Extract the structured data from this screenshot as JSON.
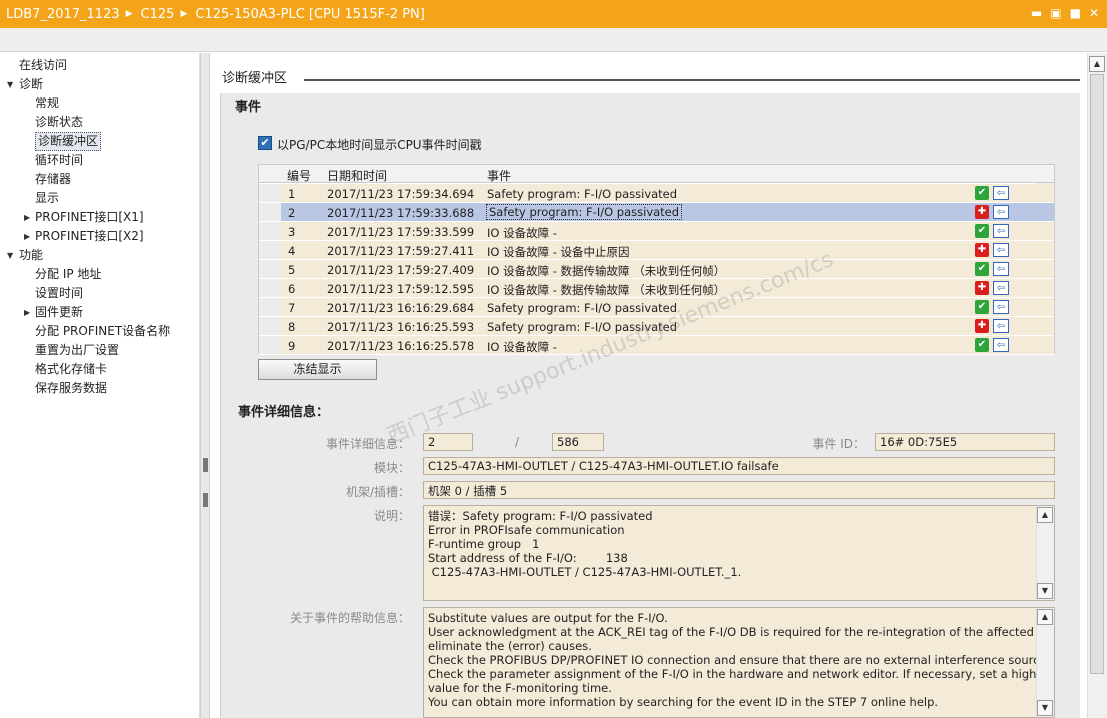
{
  "titlebar": {
    "crumbs": [
      "LDB7_2017_1123",
      "C125",
      "C125-150A3-PLC [CPU 1515F-2 PN]"
    ],
    "sep": "▶",
    "btn_min": "▬",
    "btn_restore": "▣",
    "btn_max": "■",
    "btn_close": "✕"
  },
  "nav": {
    "items": [
      {
        "label": "在线访问",
        "level": 0
      },
      {
        "label": "诊断",
        "level": 0,
        "expand": "▼"
      },
      {
        "label": "常规",
        "level": 1
      },
      {
        "label": "诊断状态",
        "level": 1
      },
      {
        "label": "诊断缓冲区",
        "level": 1,
        "selected": true
      },
      {
        "label": "循环时间",
        "level": 1
      },
      {
        "label": "存储器",
        "level": 1
      },
      {
        "label": "显示",
        "level": 1
      },
      {
        "label": "PROFINET接口[X1]",
        "level": 1,
        "expand": "▶"
      },
      {
        "label": "PROFINET接口[X2]",
        "level": 1,
        "expand": "▶"
      },
      {
        "label": "功能",
        "level": 0,
        "expand": "▼"
      },
      {
        "label": "分配 IP 地址",
        "level": 1
      },
      {
        "label": "设置时间",
        "level": 1
      },
      {
        "label": "固件更新",
        "level": 1,
        "expand": "▶"
      },
      {
        "label": "分配 PROFINET设备名称",
        "level": 1
      },
      {
        "label": "重置为出厂设置",
        "level": 1
      },
      {
        "label": "格式化存储卡",
        "level": 1
      },
      {
        "label": "保存服务数据",
        "level": 1
      }
    ]
  },
  "section_title": "诊断缓冲区",
  "events_title": "事件",
  "checkbox": {
    "checked": "✔",
    "label": "以PG/PC本地时间显示CPU事件时间戳"
  },
  "table": {
    "headers": {
      "num": "编号",
      "datetime": "日期和时间",
      "event": "事件"
    },
    "rows": [
      {
        "num": "1",
        "datetime": "2017/11/23 17:59:34.694",
        "event": "Safety program: F-I/O passivated",
        "status": "ok"
      },
      {
        "num": "2",
        "datetime": "2017/11/23 17:59:33.688",
        "event": "Safety program: F-I/O passivated",
        "status": "err",
        "selected": true
      },
      {
        "num": "3",
        "datetime": "2017/11/23 17:59:33.599",
        "event": "IO 设备故障 -",
        "status": "ok"
      },
      {
        "num": "4",
        "datetime": "2017/11/23 17:59:27.411",
        "event": "IO 设备故障 - 设备中止原因",
        "status": "err"
      },
      {
        "num": "5",
        "datetime": "2017/11/23 17:59:27.409",
        "event": "IO 设备故障 - 数据传输故障 （未收到任何帧）",
        "status": "ok"
      },
      {
        "num": "6",
        "datetime": "2017/11/23 17:59:12.595",
        "event": "IO 设备故障 - 数据传输故障 （未收到任何帧）",
        "status": "err"
      },
      {
        "num": "7",
        "datetime": "2017/11/23 16:16:29.684",
        "event": "Safety program: F-I/O passivated",
        "status": "ok"
      },
      {
        "num": "8",
        "datetime": "2017/11/23 16:16:25.593",
        "event": "Safety program: F-I/O passivated",
        "status": "err"
      },
      {
        "num": "9",
        "datetime": "2017/11/23 16:16:25.578",
        "event": "IO 设备故障 -",
        "status": "ok"
      }
    ],
    "icon_ok": "✔",
    "icon_err": "✚",
    "icon_nav": "⇦"
  },
  "freeze_button": "冻结显示",
  "details": {
    "title": "事件详细信息：",
    "event_detail_label": "事件详细信息：",
    "event_index": "2",
    "slash": "/",
    "event_total": "586",
    "event_id_label": "事件 ID：",
    "event_id": "16# 0D:75E5",
    "module_label": "模块：",
    "module": "C125-47A3-HMI-OUTLET / C125-47A3-HMI-OUTLET.IO failsafe",
    "rack_label": "机架/插槽：",
    "rack": "机架 0 / 插槽 5",
    "desc_label": "说明：",
    "desc_lines": [
      "错误：Safety program: F-I/O passivated",
      "Error in PROFIsafe communication",
      "F-runtime group   1",
      "Start address of the F-I/O:        138",
      " C125-47A3-HMI-OUTLET / C125-47A3-HMI-OUTLET._1."
    ],
    "help_label": "关于事件的帮助信息：",
    "help_lines": [
      "Substitute values are output for the F-I/O.",
      "User acknowledgment at the ACK_REI tag of the F-I/O DB is required for the re-integration of the affected F-I/O to",
      "eliminate the (error) causes.",
      "Check the PROFIBUS DP/PROFINET IO connection and ensure that there are no external interference sources.",
      "Check the parameter assignment of the F-I/O in the hardware and network editor. If necessary, set a higher",
      "value for the F-monitoring time.",
      "You can obtain more information by searching for the event ID in the STEP 7 online help."
    ]
  },
  "watermark": "西门子工业 support.industry.siemens.com/cs"
}
